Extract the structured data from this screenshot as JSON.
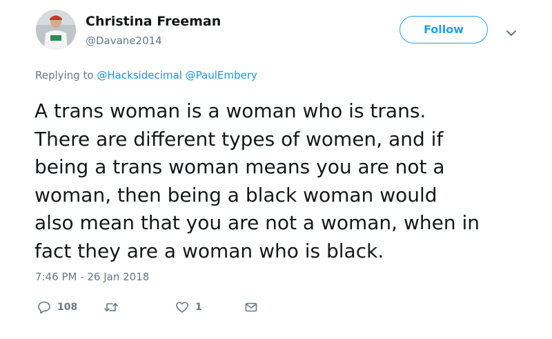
{
  "user": {
    "name": "Christina Freeman",
    "handle": "@Davane2014"
  },
  "follow_label": "Follow",
  "reply": {
    "prefix": "Replying to",
    "mentions": [
      "@Hacksidecimal",
      "@PaulEmbery"
    ]
  },
  "tweet_lines": [
    "A trans woman is a woman who is trans.",
    "There are different types of women, and if",
    "being a trans woman means you are not a",
    "woman, then being a black woman would",
    "also mean that you are not a woman, when in",
    "fact they are a woman who is black."
  ],
  "timestamp": "7:46 PM - 26 Jan 2018",
  "actions": {
    "reply_count": "108",
    "retweet_count": "",
    "like_count": "1"
  },
  "colors": {
    "accent": "#1da1f2",
    "mention": "#1b95e0",
    "secondary_text": "#657786"
  },
  "icons": [
    "profile-avatar",
    "chevron-down-icon",
    "reply-icon",
    "retweet-icon",
    "like-heart-icon",
    "direct-message-icon"
  ]
}
